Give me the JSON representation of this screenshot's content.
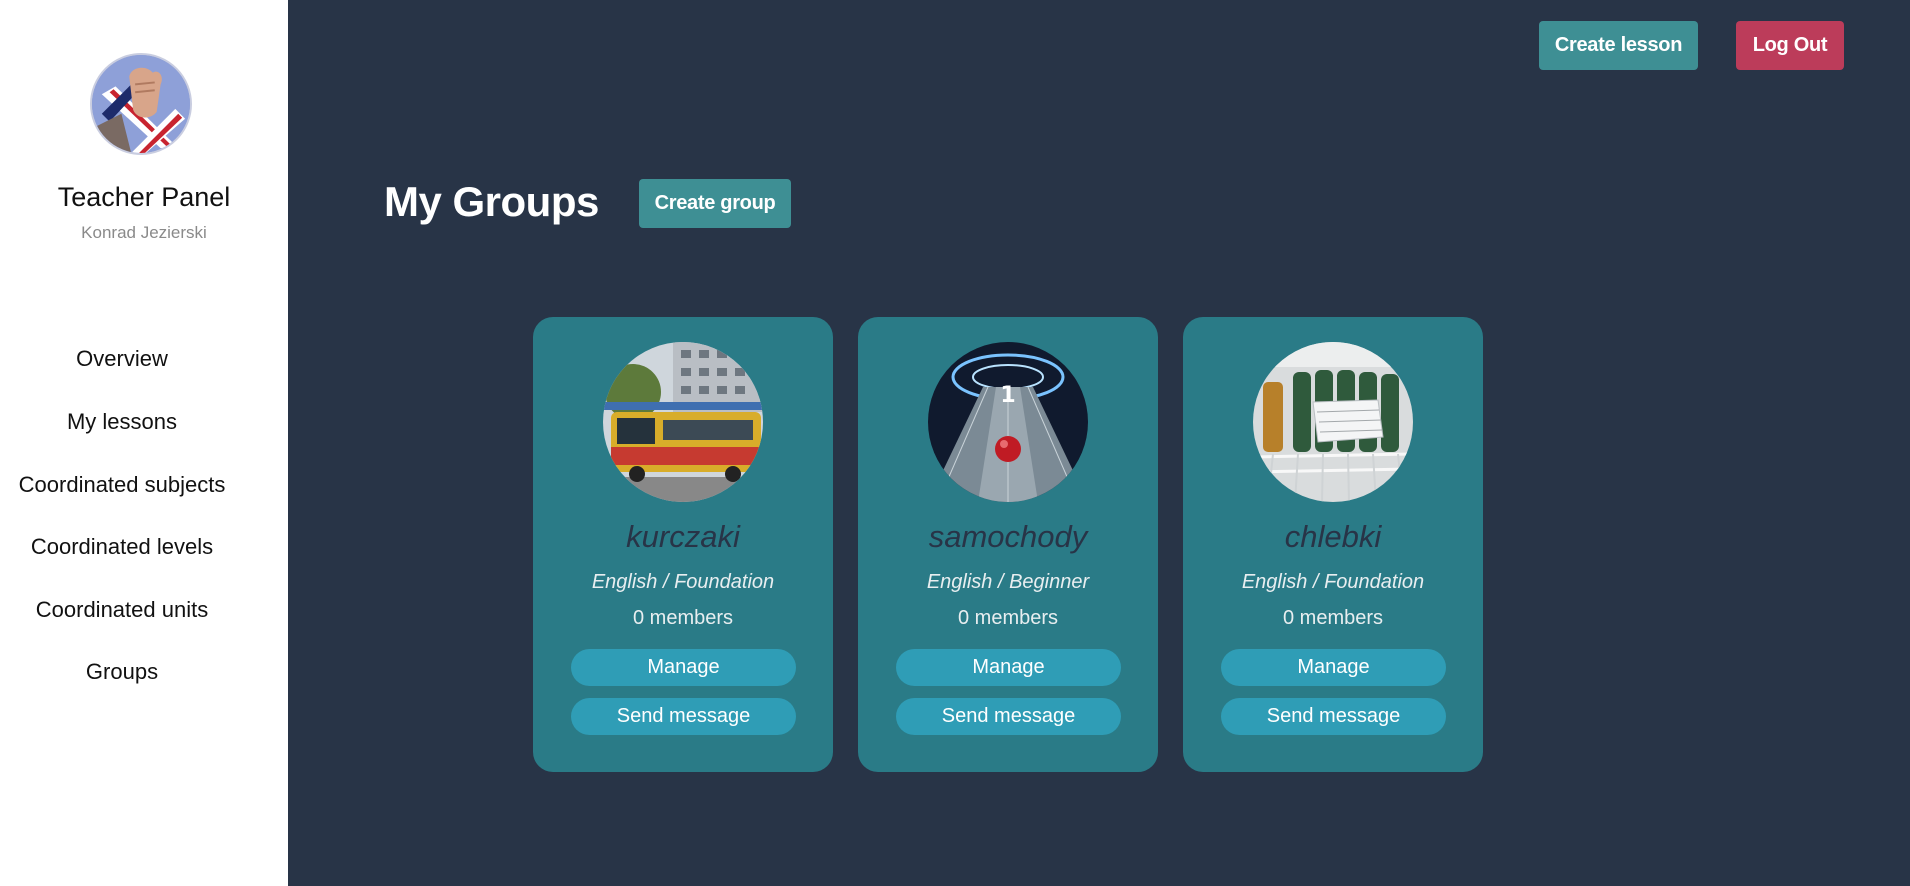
{
  "sidebar": {
    "title": "Teacher Panel",
    "user_name": "Konrad Jezierski",
    "avatar_icon": "flag-hand-avatar",
    "nav": [
      {
        "label": "Overview"
      },
      {
        "label": "My lessons"
      },
      {
        "label": "Coordinated subjects"
      },
      {
        "label": "Coordinated levels"
      },
      {
        "label": "Coordinated units"
      },
      {
        "label": "Groups"
      }
    ]
  },
  "header": {
    "create_lesson_label": "Create lesson",
    "logout_label": "Log Out"
  },
  "main": {
    "title": "My Groups",
    "create_group_label": "Create group"
  },
  "groups": [
    {
      "name": "kurczaki",
      "level": "English / Foundation",
      "members": "0 members",
      "manage_label": "Manage",
      "message_label": "Send message",
      "image": "bus-photo"
    },
    {
      "name": "samochody",
      "level": "English / Beginner",
      "members": "0 members",
      "manage_label": "Manage",
      "message_label": "Send message",
      "image": "bowling-photo"
    },
    {
      "name": "chlebki",
      "level": "English / Foundation",
      "members": "0 members",
      "manage_label": "Manage",
      "message_label": "Send message",
      "image": "fridge-photo"
    }
  ],
  "colors": {
    "background": "#283447",
    "sidebar": "#ffffff",
    "card": "#2a7b87",
    "pill": "#2f9db6",
    "teal_button": "#3e8f94",
    "red_button": "#bc3c5a"
  }
}
